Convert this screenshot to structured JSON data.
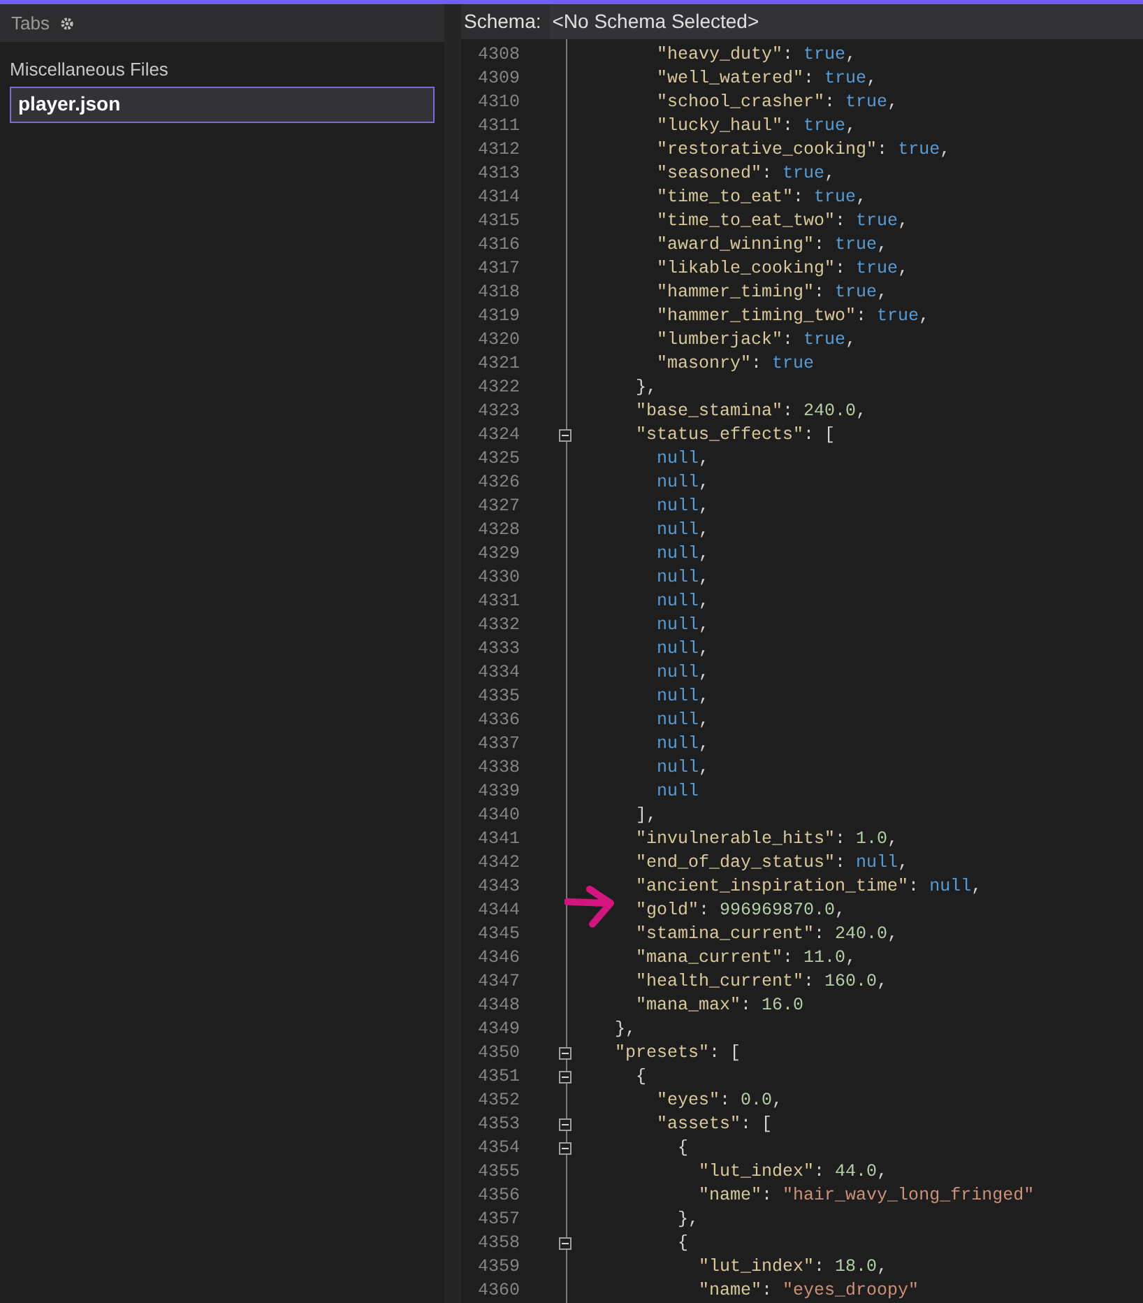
{
  "left_panel": {
    "header": "Tabs",
    "group_label": "Miscellaneous Files",
    "selected_file": {
      "name": "player.json",
      "selected": true
    }
  },
  "schema_bar": {
    "label": "Schema:",
    "value": "<No Schema Selected>"
  },
  "editor": {
    "lines": [
      {
        "number": "4308",
        "foldable": false,
        "tokens": [
          {
            "kind": "key",
            "text": "      \"heavy_duty\""
          },
          {
            "kind": "punct",
            "text": ": "
          },
          {
            "kind": "literal",
            "text": "true"
          },
          {
            "kind": "punct",
            "text": ","
          }
        ]
      },
      {
        "number": "4309",
        "foldable": false,
        "tokens": [
          {
            "kind": "key",
            "text": "      \"well_watered\""
          },
          {
            "kind": "punct",
            "text": ": "
          },
          {
            "kind": "literal",
            "text": "true"
          },
          {
            "kind": "punct",
            "text": ","
          }
        ]
      },
      {
        "number": "4310",
        "foldable": false,
        "tokens": [
          {
            "kind": "key",
            "text": "      \"school_crasher\""
          },
          {
            "kind": "punct",
            "text": ": "
          },
          {
            "kind": "literal",
            "text": "true"
          },
          {
            "kind": "punct",
            "text": ","
          }
        ]
      },
      {
        "number": "4311",
        "foldable": false,
        "tokens": [
          {
            "kind": "key",
            "text": "      \"lucky_haul\""
          },
          {
            "kind": "punct",
            "text": ": "
          },
          {
            "kind": "literal",
            "text": "true"
          },
          {
            "kind": "punct",
            "text": ","
          }
        ]
      },
      {
        "number": "4312",
        "foldable": false,
        "tokens": [
          {
            "kind": "key",
            "text": "      \"restorative_cooking\""
          },
          {
            "kind": "punct",
            "text": ": "
          },
          {
            "kind": "literal",
            "text": "true"
          },
          {
            "kind": "punct",
            "text": ","
          }
        ]
      },
      {
        "number": "4313",
        "foldable": false,
        "tokens": [
          {
            "kind": "key",
            "text": "      \"seasoned\""
          },
          {
            "kind": "punct",
            "text": ": "
          },
          {
            "kind": "literal",
            "text": "true"
          },
          {
            "kind": "punct",
            "text": ","
          }
        ]
      },
      {
        "number": "4314",
        "foldable": false,
        "tokens": [
          {
            "kind": "key",
            "text": "      \"time_to_eat\""
          },
          {
            "kind": "punct",
            "text": ": "
          },
          {
            "kind": "literal",
            "text": "true"
          },
          {
            "kind": "punct",
            "text": ","
          }
        ]
      },
      {
        "number": "4315",
        "foldable": false,
        "tokens": [
          {
            "kind": "key",
            "text": "      \"time_to_eat_two\""
          },
          {
            "kind": "punct",
            "text": ": "
          },
          {
            "kind": "literal",
            "text": "true"
          },
          {
            "kind": "punct",
            "text": ","
          }
        ]
      },
      {
        "number": "4316",
        "foldable": false,
        "tokens": [
          {
            "kind": "key",
            "text": "      \"award_winning\""
          },
          {
            "kind": "punct",
            "text": ": "
          },
          {
            "kind": "literal",
            "text": "true"
          },
          {
            "kind": "punct",
            "text": ","
          }
        ]
      },
      {
        "number": "4317",
        "foldable": false,
        "tokens": [
          {
            "kind": "key",
            "text": "      \"likable_cooking\""
          },
          {
            "kind": "punct",
            "text": ": "
          },
          {
            "kind": "literal",
            "text": "true"
          },
          {
            "kind": "punct",
            "text": ","
          }
        ]
      },
      {
        "number": "4318",
        "foldable": false,
        "tokens": [
          {
            "kind": "key",
            "text": "      \"hammer_timing\""
          },
          {
            "kind": "punct",
            "text": ": "
          },
          {
            "kind": "literal",
            "text": "true"
          },
          {
            "kind": "punct",
            "text": ","
          }
        ]
      },
      {
        "number": "4319",
        "foldable": false,
        "tokens": [
          {
            "kind": "key",
            "text": "      \"hammer_timing_two\""
          },
          {
            "kind": "punct",
            "text": ": "
          },
          {
            "kind": "literal",
            "text": "true"
          },
          {
            "kind": "punct",
            "text": ","
          }
        ]
      },
      {
        "number": "4320",
        "foldable": false,
        "tokens": [
          {
            "kind": "key",
            "text": "      \"lumberjack\""
          },
          {
            "kind": "punct",
            "text": ": "
          },
          {
            "kind": "literal",
            "text": "true"
          },
          {
            "kind": "punct",
            "text": ","
          }
        ]
      },
      {
        "number": "4321",
        "foldable": false,
        "tokens": [
          {
            "kind": "key",
            "text": "      \"masonry\""
          },
          {
            "kind": "punct",
            "text": ": "
          },
          {
            "kind": "literal",
            "text": "true"
          }
        ]
      },
      {
        "number": "4322",
        "foldable": false,
        "tokens": [
          {
            "kind": "punct",
            "text": "    },"
          }
        ]
      },
      {
        "number": "4323",
        "foldable": false,
        "tokens": [
          {
            "kind": "key",
            "text": "    \"base_stamina\""
          },
          {
            "kind": "punct",
            "text": ": "
          },
          {
            "kind": "number",
            "text": "240.0"
          },
          {
            "kind": "punct",
            "text": ","
          }
        ]
      },
      {
        "number": "4324",
        "foldable": true,
        "tokens": [
          {
            "kind": "key",
            "text": "    \"status_effects\""
          },
          {
            "kind": "punct",
            "text": ": ["
          }
        ]
      },
      {
        "number": "4325",
        "foldable": false,
        "tokens": [
          {
            "kind": "literal",
            "text": "      null"
          },
          {
            "kind": "punct",
            "text": ","
          }
        ]
      },
      {
        "number": "4326",
        "foldable": false,
        "tokens": [
          {
            "kind": "literal",
            "text": "      null"
          },
          {
            "kind": "punct",
            "text": ","
          }
        ]
      },
      {
        "number": "4327",
        "foldable": false,
        "tokens": [
          {
            "kind": "literal",
            "text": "      null"
          },
          {
            "kind": "punct",
            "text": ","
          }
        ]
      },
      {
        "number": "4328",
        "foldable": false,
        "tokens": [
          {
            "kind": "literal",
            "text": "      null"
          },
          {
            "kind": "punct",
            "text": ","
          }
        ]
      },
      {
        "number": "4329",
        "foldable": false,
        "tokens": [
          {
            "kind": "literal",
            "text": "      null"
          },
          {
            "kind": "punct",
            "text": ","
          }
        ]
      },
      {
        "number": "4330",
        "foldable": false,
        "tokens": [
          {
            "kind": "literal",
            "text": "      null"
          },
          {
            "kind": "punct",
            "text": ","
          }
        ]
      },
      {
        "number": "4331",
        "foldable": false,
        "tokens": [
          {
            "kind": "literal",
            "text": "      null"
          },
          {
            "kind": "punct",
            "text": ","
          }
        ]
      },
      {
        "number": "4332",
        "foldable": false,
        "tokens": [
          {
            "kind": "literal",
            "text": "      null"
          },
          {
            "kind": "punct",
            "text": ","
          }
        ]
      },
      {
        "number": "4333",
        "foldable": false,
        "tokens": [
          {
            "kind": "literal",
            "text": "      null"
          },
          {
            "kind": "punct",
            "text": ","
          }
        ]
      },
      {
        "number": "4334",
        "foldable": false,
        "tokens": [
          {
            "kind": "literal",
            "text": "      null"
          },
          {
            "kind": "punct",
            "text": ","
          }
        ]
      },
      {
        "number": "4335",
        "foldable": false,
        "tokens": [
          {
            "kind": "literal",
            "text": "      null"
          },
          {
            "kind": "punct",
            "text": ","
          }
        ]
      },
      {
        "number": "4336",
        "foldable": false,
        "tokens": [
          {
            "kind": "literal",
            "text": "      null"
          },
          {
            "kind": "punct",
            "text": ","
          }
        ]
      },
      {
        "number": "4337",
        "foldable": false,
        "tokens": [
          {
            "kind": "literal",
            "text": "      null"
          },
          {
            "kind": "punct",
            "text": ","
          }
        ]
      },
      {
        "number": "4338",
        "foldable": false,
        "tokens": [
          {
            "kind": "literal",
            "text": "      null"
          },
          {
            "kind": "punct",
            "text": ","
          }
        ]
      },
      {
        "number": "4339",
        "foldable": false,
        "tokens": [
          {
            "kind": "literal",
            "text": "      null"
          }
        ]
      },
      {
        "number": "4340",
        "foldable": false,
        "tokens": [
          {
            "kind": "punct",
            "text": "    ],"
          }
        ]
      },
      {
        "number": "4341",
        "foldable": false,
        "tokens": [
          {
            "kind": "key",
            "text": "    \"invulnerable_hits\""
          },
          {
            "kind": "punct",
            "text": ": "
          },
          {
            "kind": "number",
            "text": "1.0"
          },
          {
            "kind": "punct",
            "text": ","
          }
        ]
      },
      {
        "number": "4342",
        "foldable": false,
        "tokens": [
          {
            "kind": "key",
            "text": "    \"end_of_day_status\""
          },
          {
            "kind": "punct",
            "text": ": "
          },
          {
            "kind": "literal",
            "text": "null"
          },
          {
            "kind": "punct",
            "text": ","
          }
        ]
      },
      {
        "number": "4343",
        "foldable": false,
        "tokens": [
          {
            "kind": "key",
            "text": "    \"ancient_inspiration_time\""
          },
          {
            "kind": "punct",
            "text": ": "
          },
          {
            "kind": "literal",
            "text": "null"
          },
          {
            "kind": "punct",
            "text": ","
          }
        ]
      },
      {
        "number": "4344",
        "foldable": false,
        "tokens": [
          {
            "kind": "key",
            "text": "    \"gold\""
          },
          {
            "kind": "punct",
            "text": ": "
          },
          {
            "kind": "number",
            "text": "996969870.0"
          },
          {
            "kind": "punct",
            "text": ","
          }
        ]
      },
      {
        "number": "4345",
        "foldable": false,
        "tokens": [
          {
            "kind": "key",
            "text": "    \"stamina_current\""
          },
          {
            "kind": "punct",
            "text": ": "
          },
          {
            "kind": "number",
            "text": "240.0"
          },
          {
            "kind": "punct",
            "text": ","
          }
        ]
      },
      {
        "number": "4346",
        "foldable": false,
        "tokens": [
          {
            "kind": "key",
            "text": "    \"mana_current\""
          },
          {
            "kind": "punct",
            "text": ": "
          },
          {
            "kind": "number",
            "text": "11.0"
          },
          {
            "kind": "punct",
            "text": ","
          }
        ]
      },
      {
        "number": "4347",
        "foldable": false,
        "tokens": [
          {
            "kind": "key",
            "text": "    \"health_current\""
          },
          {
            "kind": "punct",
            "text": ": "
          },
          {
            "kind": "number",
            "text": "160.0"
          },
          {
            "kind": "punct",
            "text": ","
          }
        ]
      },
      {
        "number": "4348",
        "foldable": false,
        "tokens": [
          {
            "kind": "key",
            "text": "    \"mana_max\""
          },
          {
            "kind": "punct",
            "text": ": "
          },
          {
            "kind": "number",
            "text": "16.0"
          }
        ]
      },
      {
        "number": "4349",
        "foldable": false,
        "tokens": [
          {
            "kind": "punct",
            "text": "  },"
          }
        ]
      },
      {
        "number": "4350",
        "foldable": true,
        "tokens": [
          {
            "kind": "key",
            "text": "  \"presets\""
          },
          {
            "kind": "punct",
            "text": ": ["
          }
        ]
      },
      {
        "number": "4351",
        "foldable": true,
        "tokens": [
          {
            "kind": "punct",
            "text": "    {"
          }
        ]
      },
      {
        "number": "4352",
        "foldable": false,
        "tokens": [
          {
            "kind": "key",
            "text": "      \"eyes\""
          },
          {
            "kind": "punct",
            "text": ": "
          },
          {
            "kind": "number",
            "text": "0.0"
          },
          {
            "kind": "punct",
            "text": ","
          }
        ]
      },
      {
        "number": "4353",
        "foldable": true,
        "tokens": [
          {
            "kind": "key",
            "text": "      \"assets\""
          },
          {
            "kind": "punct",
            "text": ": ["
          }
        ]
      },
      {
        "number": "4354",
        "foldable": true,
        "tokens": [
          {
            "kind": "punct",
            "text": "        {"
          }
        ]
      },
      {
        "number": "4355",
        "foldable": false,
        "tokens": [
          {
            "kind": "key",
            "text": "          \"lut_index\""
          },
          {
            "kind": "punct",
            "text": ": "
          },
          {
            "kind": "number",
            "text": "44.0"
          },
          {
            "kind": "punct",
            "text": ","
          }
        ]
      },
      {
        "number": "4356",
        "foldable": false,
        "tokens": [
          {
            "kind": "key",
            "text": "          \"name\""
          },
          {
            "kind": "punct",
            "text": ": "
          },
          {
            "kind": "string",
            "text": "\"hair_wavy_long_fringed\""
          }
        ]
      },
      {
        "number": "4357",
        "foldable": false,
        "tokens": [
          {
            "kind": "punct",
            "text": "        },"
          }
        ]
      },
      {
        "number": "4358",
        "foldable": true,
        "tokens": [
          {
            "kind": "punct",
            "text": "        {"
          }
        ]
      },
      {
        "number": "4359",
        "foldable": false,
        "tokens": [
          {
            "kind": "key",
            "text": "          \"lut_index\""
          },
          {
            "kind": "punct",
            "text": ": "
          },
          {
            "kind": "number",
            "text": "18.0"
          },
          {
            "kind": "punct",
            "text": ","
          }
        ]
      },
      {
        "number": "4360",
        "foldable": false,
        "tokens": [
          {
            "kind": "key",
            "text": "          \"name\""
          },
          {
            "kind": "punct",
            "text": ": "
          },
          {
            "kind": "string",
            "text": "\"eyes_droopy\""
          }
        ]
      }
    ]
  }
}
